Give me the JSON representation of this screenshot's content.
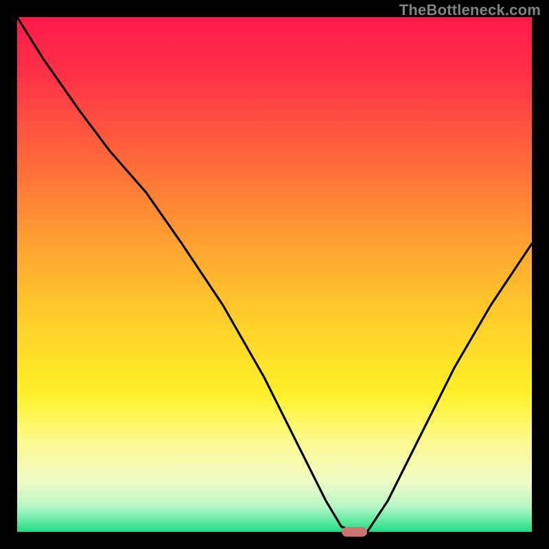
{
  "watermark": "TheBottleneck.com",
  "colors": {
    "frame": "#000000",
    "marker": "#cb736e",
    "curve": "#000000"
  },
  "gradient_stops": [
    {
      "pct": 0,
      "color": "#ff1a4b"
    },
    {
      "pct": 12,
      "color": "#ff3346"
    },
    {
      "pct": 28,
      "color": "#ff6a3a"
    },
    {
      "pct": 45,
      "color": "#ffa531"
    },
    {
      "pct": 60,
      "color": "#ffd22a"
    },
    {
      "pct": 73,
      "color": "#fff028"
    },
    {
      "pct": 82,
      "color": "#fdfa8a"
    },
    {
      "pct": 90,
      "color": "#f0fbc6"
    },
    {
      "pct": 95,
      "color": "#b9f6c6"
    },
    {
      "pct": 98,
      "color": "#5de9a0"
    },
    {
      "pct": 100,
      "color": "#1fdc83"
    }
  ],
  "chart_data": {
    "type": "line",
    "title": "",
    "xlabel": "",
    "ylabel": "",
    "xlim": [
      0,
      100
    ],
    "ylim": [
      0,
      100
    ],
    "note": "V-shaped bottleneck curve on a bottleneck-severity color field. Minimum (zero bottleneck / green zone) occurs around x≈63–68. x and y are read as percent of plot width/height; y=0 is the optimal (bottom) edge.",
    "series": [
      {
        "name": "bottleneck-curve",
        "x": [
          0,
          5,
          12,
          18,
          25,
          32,
          40,
          48,
          55,
          60,
          63,
          66,
          68,
          72,
          78,
          85,
          92,
          100
        ],
        "y": [
          100,
          92,
          82,
          74,
          66,
          56,
          44,
          30,
          16,
          6,
          1,
          0,
          0,
          6,
          18,
          32,
          44,
          56
        ]
      }
    ],
    "marker": {
      "name": "optimal-point",
      "x_range": [
        63,
        68
      ],
      "y": 0,
      "color": "#cb736e"
    }
  }
}
